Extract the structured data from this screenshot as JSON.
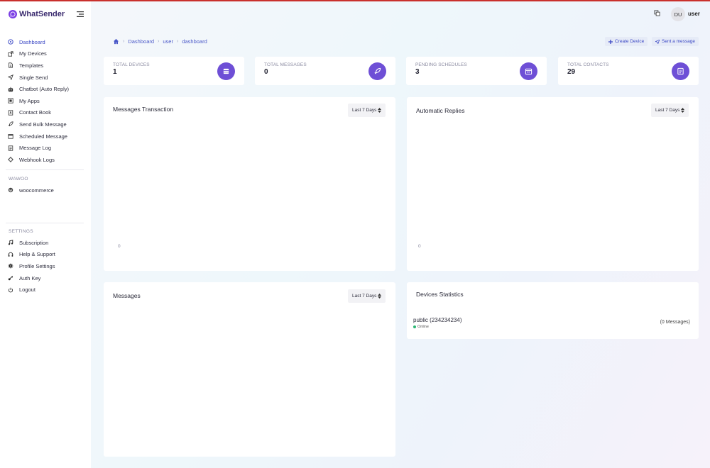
{
  "brand": {
    "name": "WhatSender"
  },
  "sidebar": {
    "items": [
      {
        "label": "Dashboard",
        "icon": "dashboard-icon"
      },
      {
        "label": "My Devices",
        "icon": "external-link-icon"
      },
      {
        "label": "Templates",
        "icon": "file-icon"
      },
      {
        "label": "Single Send",
        "icon": "paper-plane-icon"
      },
      {
        "label": "Chatbot (Auto Reply)",
        "icon": "robot-icon"
      },
      {
        "label": "My Apps",
        "icon": "apps-icon"
      },
      {
        "label": "Contact Book",
        "icon": "contact-book-icon"
      },
      {
        "label": "Send Bulk Message",
        "icon": "rocket-icon"
      },
      {
        "label": "Scheduled Message",
        "icon": "calendar-icon"
      },
      {
        "label": "Message Log",
        "icon": "log-icon"
      },
      {
        "label": "Webhook Logs",
        "icon": "webhook-icon"
      }
    ],
    "section_wawoo": "WAWOO",
    "wawoo_items": [
      {
        "label": "woocommerce",
        "icon": "wordpress-icon"
      }
    ],
    "section_settings": "SETTINGS",
    "settings_items": [
      {
        "label": "Subscription",
        "icon": "music-icon"
      },
      {
        "label": "Help & Support",
        "icon": "headset-icon"
      },
      {
        "label": "Profile Settings",
        "icon": "gear-icon"
      },
      {
        "label": "Auth Key",
        "icon": "key-icon"
      },
      {
        "label": "Logout",
        "icon": "power-icon"
      }
    ]
  },
  "topbar": {
    "avatar_initials": "DU",
    "username": "user"
  },
  "breadcrumb": {
    "items": [
      "Dashboard",
      "user",
      "dashboard"
    ]
  },
  "actions": {
    "create_device": "Create Device",
    "sent_message": "Sent a message"
  },
  "stats": [
    {
      "label": "TOTAL DEVICES",
      "value": "1",
      "icon": "server-icon"
    },
    {
      "label": "TOTAL MESSAGES",
      "value": "0",
      "icon": "rocket-icon"
    },
    {
      "label": "PENDING SCHEDULES",
      "value": "3",
      "icon": "calendar-icon"
    },
    {
      "label": "TOTAL CONTACTS",
      "value": "29",
      "icon": "contacts-icon"
    }
  ],
  "cards": {
    "messages_transaction": {
      "title": "Messages Transaction",
      "range": "Last 7 Days",
      "axis_zero": "0"
    },
    "automatic_replies": {
      "title": "Automatic Replies",
      "range": "Last 7 Days",
      "axis_zero": "0"
    },
    "messages": {
      "title": "Messages",
      "range": "Last 7 Days"
    },
    "devices_statistics": {
      "title": "Devices Statistics",
      "device_name": "public (234234234)",
      "device_status": "Online",
      "device_messages": "(0 Messages)"
    }
  },
  "colors": {
    "accent": "#6e4fd6",
    "link": "#3b48c5",
    "online": "#2bb673",
    "topline": "#c9302c"
  }
}
